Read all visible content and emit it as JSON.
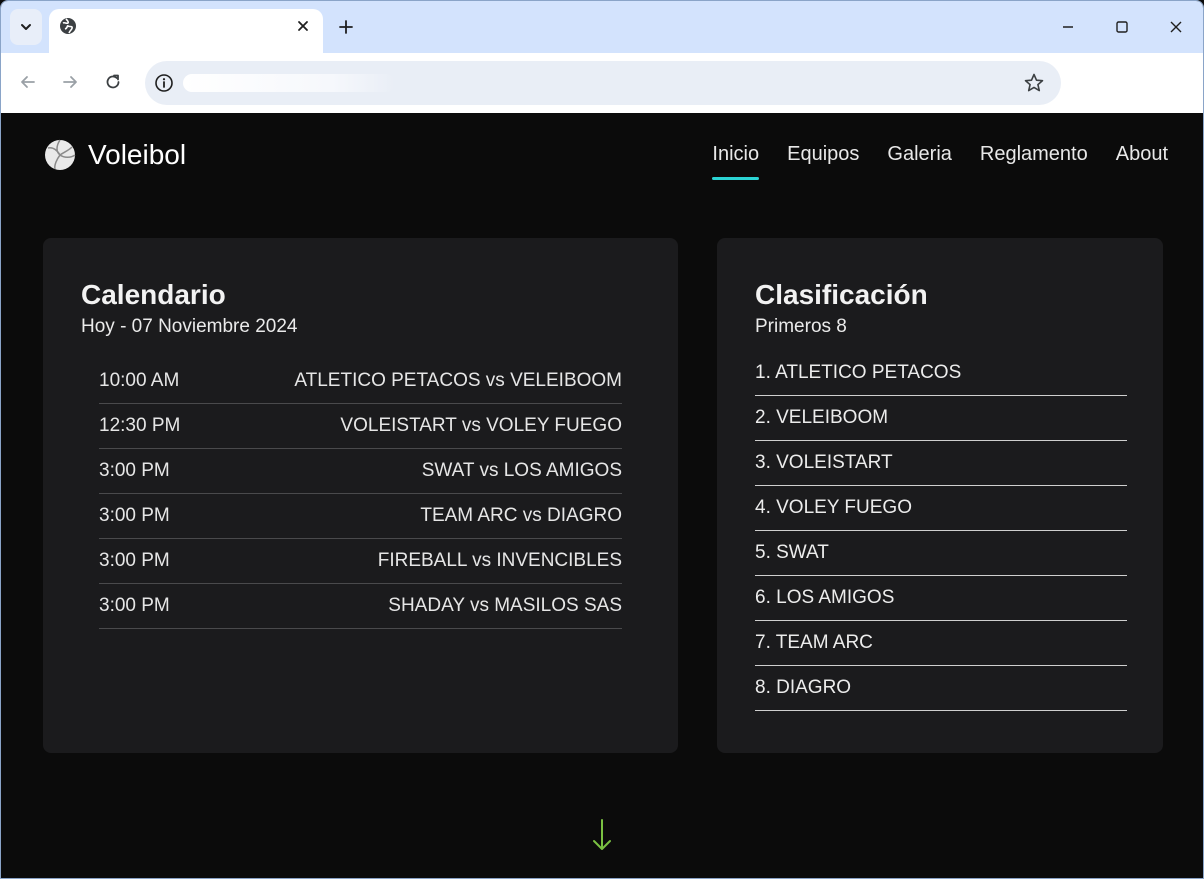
{
  "browser": {
    "tab_title": "",
    "url_value": "",
    "colors": {
      "tabstrip": "#d3e3fd",
      "toolbar": "#ffffff"
    }
  },
  "site": {
    "brand": "Voleibol",
    "logo_icon": "volleyball-icon",
    "nav": [
      {
        "label": "Inicio",
        "active": true
      },
      {
        "label": "Equipos",
        "active": false
      },
      {
        "label": "Galeria",
        "active": false
      },
      {
        "label": "Reglamento",
        "active": false
      },
      {
        "label": "About",
        "active": false
      }
    ],
    "accent_color": "#2bd4d4"
  },
  "calendario": {
    "title": "Calendario",
    "subtitle": "Hoy - 07 Noviembre 2024",
    "matches": [
      {
        "time": "10:00 AM",
        "teams": "ATLETICO PETACOS vs VELEIBOOM"
      },
      {
        "time": "12:30 PM",
        "teams": "VOLEISTART vs VOLEY FUEGO"
      },
      {
        "time": "3:00 PM",
        "teams": "SWAT vs LOS AMIGOS"
      },
      {
        "time": "3:00 PM",
        "teams": "TEAM ARC vs DIAGRO"
      },
      {
        "time": "3:00 PM",
        "teams": "FIREBALL vs INVENCIBLES"
      },
      {
        "time": "3:00 PM",
        "teams": "SHADAY vs MASILOS SAS"
      }
    ]
  },
  "clasificacion": {
    "title": "Clasificación",
    "subtitle": "Primeros 8",
    "teams": [
      "1. ATLETICO PETACOS",
      "2. VELEIBOOM",
      "3. VOLEISTART",
      "4. VOLEY FUEGO",
      "5. SWAT",
      "6. LOS AMIGOS",
      "7. TEAM ARC",
      "8. DIAGRO"
    ]
  },
  "scroll_hint": {
    "icon": "arrow-down-icon",
    "color": "#7ac142"
  }
}
